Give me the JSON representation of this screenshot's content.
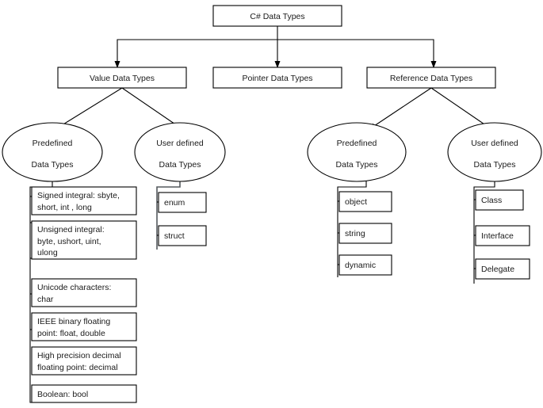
{
  "diagram": {
    "title": "C# Data Types",
    "root": {
      "label": "C# Data Types"
    },
    "categories": [
      {
        "label": "Value Data Types"
      },
      {
        "label": "Pointer Data Types"
      },
      {
        "label": "Reference Data Types"
      }
    ],
    "groups": [
      {
        "name": "value-predefined",
        "ellipse_line1": "Predefined",
        "ellipse_line2": "Data Types",
        "items": [
          {
            "lines": [
              "Signed integral: sbyte,",
              "short, int , long"
            ]
          },
          {
            "lines": [
              "Unsigned integral:",
              "byte, ushort, uint,",
              "ulong"
            ]
          },
          {
            "lines": [
              "Unicode characters:",
              "char"
            ]
          },
          {
            "lines": [
              "IEEE binary floating",
              "point: float, double"
            ]
          },
          {
            "lines": [
              "High precision decimal",
              "floating point: decimal"
            ]
          },
          {
            "lines": [
              "Boolean: bool"
            ]
          }
        ]
      },
      {
        "name": "value-userdefined",
        "ellipse_line1": "User defined",
        "ellipse_line2": "Data Types",
        "items": [
          {
            "lines": [
              "enum"
            ]
          },
          {
            "lines": [
              "struct"
            ]
          }
        ]
      },
      {
        "name": "reference-predefined",
        "ellipse_line1": "Predefined",
        "ellipse_line2": "Data Types",
        "items": [
          {
            "lines": [
              "object"
            ]
          },
          {
            "lines": [
              "string"
            ]
          },
          {
            "lines": [
              "dynamic"
            ]
          }
        ]
      },
      {
        "name": "reference-userdefined",
        "ellipse_line1": "User defined",
        "ellipse_line2": "Data Types",
        "items": [
          {
            "lines": [
              "Class"
            ]
          },
          {
            "lines": [
              "Interface"
            ]
          },
          {
            "lines": [
              "Delegate"
            ]
          }
        ]
      }
    ],
    "colors": {
      "stroke": "#000000",
      "fill": "#ffffff",
      "text": "#1a1a1a"
    }
  }
}
